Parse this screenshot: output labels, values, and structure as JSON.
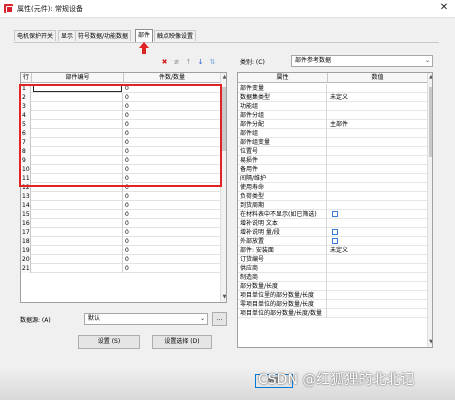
{
  "window": {
    "title": "属性(元件): 常规设备",
    "close_glyph": "✕"
  },
  "tabs": [
    {
      "label": "电机保护开关",
      "active": false
    },
    {
      "label": "显示",
      "active": false
    },
    {
      "label": "符号数据/功能数据",
      "active": false
    },
    {
      "label": "部件",
      "active": true
    },
    {
      "label": "触点映像设置",
      "active": false
    }
  ],
  "toolbar": {
    "icons": [
      "delete-icon",
      "insert-icon",
      "move-up-icon",
      "move-down-icon",
      "sort-icon"
    ]
  },
  "parts_grid": {
    "columns": [
      "行",
      "部件编号",
      "件数/数量"
    ],
    "rows": [
      {
        "n": "1",
        "qty": "0"
      },
      {
        "n": "2",
        "qty": "0"
      },
      {
        "n": "3",
        "qty": "0"
      },
      {
        "n": "4",
        "qty": "0"
      },
      {
        "n": "5",
        "qty": "0"
      },
      {
        "n": "6",
        "qty": "0"
      },
      {
        "n": "7",
        "qty": "0"
      },
      {
        "n": "8",
        "qty": "0"
      },
      {
        "n": "9",
        "qty": "0"
      },
      {
        "n": "10",
        "qty": "0"
      },
      {
        "n": "11",
        "qty": "0"
      },
      {
        "n": "12",
        "qty": "0"
      },
      {
        "n": "13",
        "qty": "0"
      },
      {
        "n": "14",
        "qty": "0"
      },
      {
        "n": "15",
        "qty": "0"
      },
      {
        "n": "16",
        "qty": "0"
      },
      {
        "n": "17",
        "qty": "0"
      },
      {
        "n": "18",
        "qty": "0"
      },
      {
        "n": "19",
        "qty": "0"
      },
      {
        "n": "20",
        "qty": "0"
      },
      {
        "n": "21",
        "qty": "0"
      }
    ],
    "highlight_color": "#e02424"
  },
  "datasource": {
    "label": "数据源: (A)",
    "value": "默认",
    "more": "..."
  },
  "buttons": {
    "settings": "设置 (S)",
    "settings_select": "设置选择 (D)",
    "ok": "确定"
  },
  "category": {
    "label": "类别: (C)",
    "value": "部件参考数据"
  },
  "properties": {
    "columns": [
      "属性",
      "数值"
    ],
    "rows": [
      {
        "k": "部件变量",
        "v": "",
        "chk": false
      },
      {
        "k": "数据集类型",
        "v": "未定义",
        "chk": false
      },
      {
        "k": "功能组",
        "v": "",
        "chk": false
      },
      {
        "k": "部件分组",
        "v": "",
        "chk": false
      },
      {
        "k": "部件分配",
        "v": "主部件",
        "chk": false
      },
      {
        "k": "部件组",
        "v": "",
        "chk": false
      },
      {
        "k": "部件组变量",
        "v": "",
        "chk": false
      },
      {
        "k": "位置号",
        "v": "",
        "chk": false
      },
      {
        "k": "易损件",
        "v": "",
        "chk": false
      },
      {
        "k": "备用件",
        "v": "",
        "chk": false
      },
      {
        "k": "间隔/维护",
        "v": "",
        "chk": false
      },
      {
        "k": "使用寿命",
        "v": "",
        "chk": false
      },
      {
        "k": "负荷类型",
        "v": "",
        "chk": false
      },
      {
        "k": "到货周期",
        "v": "",
        "chk": false
      },
      {
        "k": "在材料表中不显示(如已筛选)",
        "v": "",
        "chk": true
      },
      {
        "k": "增补说明 文本",
        "v": "",
        "chk": false
      },
      {
        "k": "增补说明 量/段",
        "v": "",
        "chk": true
      },
      {
        "k": "外部放置",
        "v": "",
        "chk": true
      },
      {
        "k": "部件: 安装面",
        "v": "未定义",
        "chk": false
      },
      {
        "k": "订货编号",
        "v": "",
        "chk": false
      },
      {
        "k": "供应商",
        "v": "",
        "chk": false
      },
      {
        "k": "制造商",
        "v": "",
        "chk": false
      },
      {
        "k": "部分数量/长度",
        "v": "",
        "chk": false
      },
      {
        "k": "项目单位里的部分数量/长度",
        "v": "",
        "chk": false
      },
      {
        "k": "零项目单位的部分数量/长度",
        "v": "",
        "chk": false
      },
      {
        "k": "项目单位的部分数量/长度/数量",
        "v": "",
        "chk": false
      }
    ]
  },
  "watermark": "CSDN @红狐狸的北北记"
}
